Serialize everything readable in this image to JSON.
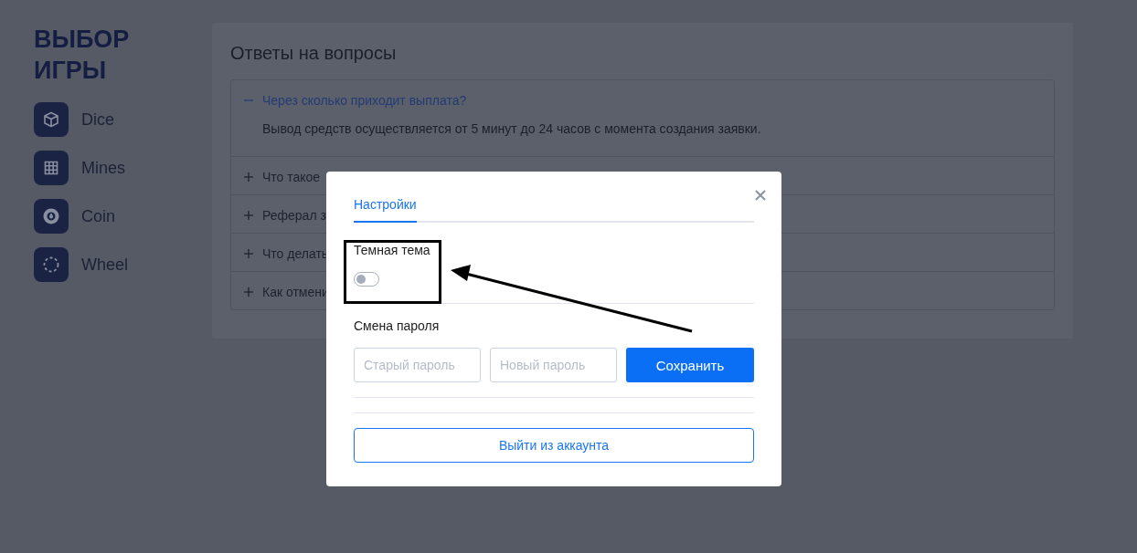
{
  "sidebar": {
    "title": "ВЫБОР ИГРЫ",
    "items": [
      {
        "label": "Dice",
        "kind": "cube"
      },
      {
        "label": "Mines",
        "kind": "grid"
      },
      {
        "label": "Coin",
        "kind": "coin"
      },
      {
        "label": "Wheel",
        "kind": "wheel"
      }
    ]
  },
  "faq": {
    "title": "Ответы на вопросы",
    "items": [
      {
        "question": "Через сколько приходит выплата?",
        "expanded": true,
        "answer": "Вывод средств осуществляется от 5 минут до 24 часов с момента создания заявки."
      },
      {
        "question": "Что такое",
        "expanded": false
      },
      {
        "question": "Реферал з",
        "expanded": false
      },
      {
        "question": "Что делать",
        "expanded": false
      },
      {
        "question": "Как отмени",
        "expanded": false
      }
    ]
  },
  "modal": {
    "tabs": [
      {
        "label": "Настройки",
        "selected": true
      }
    ],
    "dark_theme": {
      "label": "Темная тема",
      "on": false
    },
    "password": {
      "title": "Смена пароля",
      "old_placeholder": "Старый пароль",
      "new_placeholder": "Новый пароль",
      "save": "Сохранить"
    },
    "logout": "Выйти из аккаунта"
  }
}
